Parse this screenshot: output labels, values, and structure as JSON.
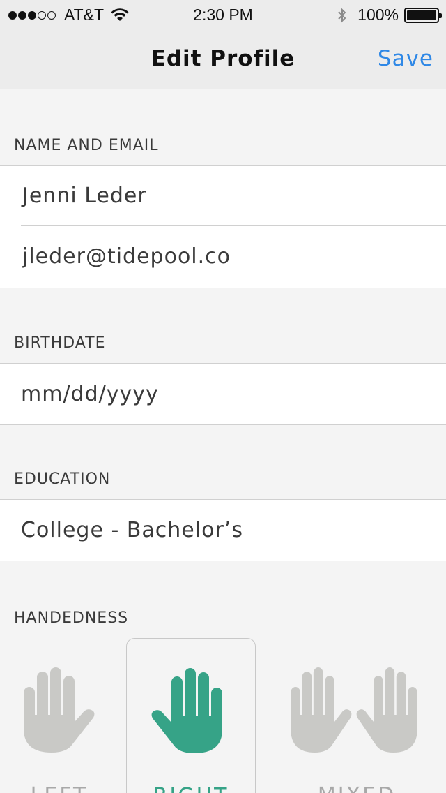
{
  "status_bar": {
    "signal": {
      "filled": 3,
      "empty": 2
    },
    "carrier": "AT&T",
    "time": "2:30 PM",
    "battery_percent": "100%"
  },
  "nav": {
    "title": "Edit Profile",
    "save_label": "Save"
  },
  "sections": {
    "name_email": {
      "header": "NAME AND EMAIL",
      "name_value": "Jenni Leder",
      "email_value": "jleder@tidepool.co"
    },
    "birthdate": {
      "header": "BIRTHDATE",
      "placeholder": "mm/dd/yyyy"
    },
    "education": {
      "header": "EDUCATION",
      "value": "College - Bachelor’s"
    },
    "handedness": {
      "header": "HANDEDNESS",
      "options": [
        {
          "label": "LEFT",
          "icon": "left-hand-icon",
          "selected": false
        },
        {
          "label": "RIGHT",
          "icon": "right-hand-icon",
          "selected": true
        },
        {
          "label": "MIXED",
          "icon": "both-hands-icon",
          "selected": false
        }
      ]
    }
  },
  "colors": {
    "accent_blue": "#2f88e6",
    "selected_green": "#36a387",
    "unselected_grey": "#c9c9c6"
  }
}
